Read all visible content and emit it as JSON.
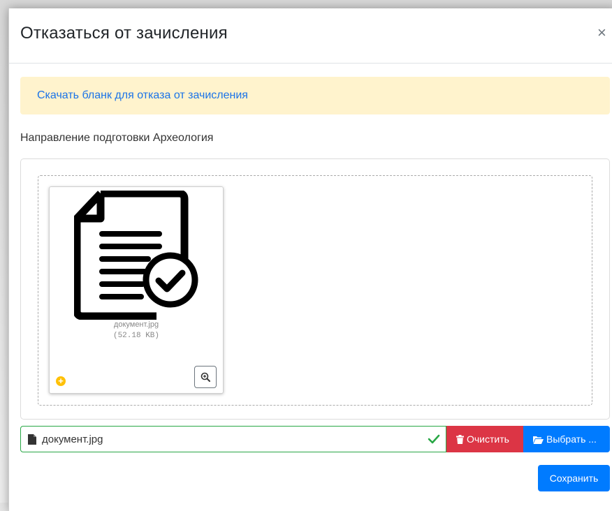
{
  "modal": {
    "title": "Отказаться от зачисления",
    "close_label": "×"
  },
  "alert": {
    "link_text": "Скачать бланк для отказа от зачисления"
  },
  "direction_label": "Направление подготовки Археология",
  "preview": {
    "file_name": "документ.jpg",
    "file_size": "(52.18 KB)",
    "icon": "document-check-icon"
  },
  "file_input": {
    "caption": "документ.jpg",
    "clear_label": "Очистить",
    "browse_label": "Выбрать ..."
  },
  "save_label": "Сохранить",
  "colors": {
    "primary": "#007bff",
    "danger": "#dc3545",
    "success": "#28a745",
    "warning_bg": "#fff3cd",
    "link": "#1a73e8"
  }
}
